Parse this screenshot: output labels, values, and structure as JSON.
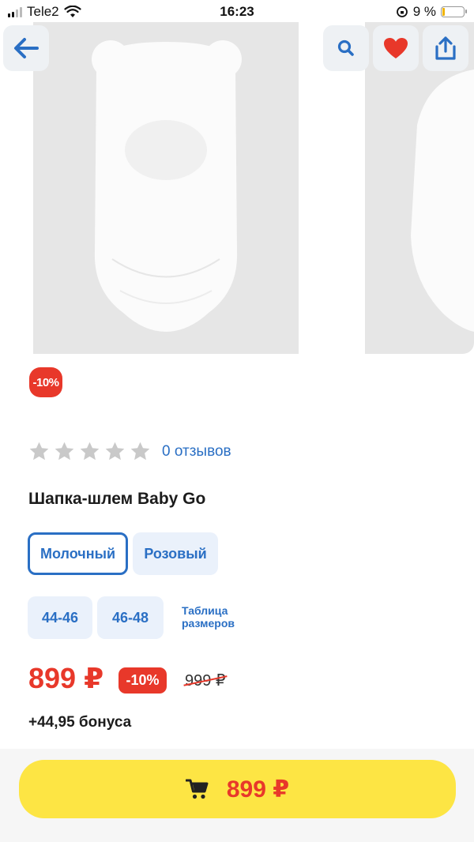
{
  "status_bar": {
    "carrier": "Tele2",
    "time": "16:23",
    "battery_percent": "9 %"
  },
  "gallery": {
    "icons": [
      "back-arrow-icon",
      "search-icon",
      "heart-icon",
      "share-icon"
    ]
  },
  "product": {
    "discount_badge": "-10%",
    "rating": 0,
    "reviews": "0 отзывов",
    "title": "Шапка-шлем Baby Go",
    "colors": [
      {
        "label": "Молочный",
        "selected": true
      },
      {
        "label": "Розовый",
        "selected": false
      }
    ],
    "sizes": [
      "44-46",
      "46-48"
    ],
    "size_table_link": "Таблица размеров",
    "price": "899 ₽",
    "price_discount": "-10%",
    "old_price": "999 ₽",
    "bonus": "+44,95 бонуса"
  },
  "buy_button": {
    "price": "899 ₽"
  },
  "colors": {
    "accent_blue": "#2a6fc4",
    "sale_red": "#e8382a",
    "buy_yellow": "#fde544"
  }
}
